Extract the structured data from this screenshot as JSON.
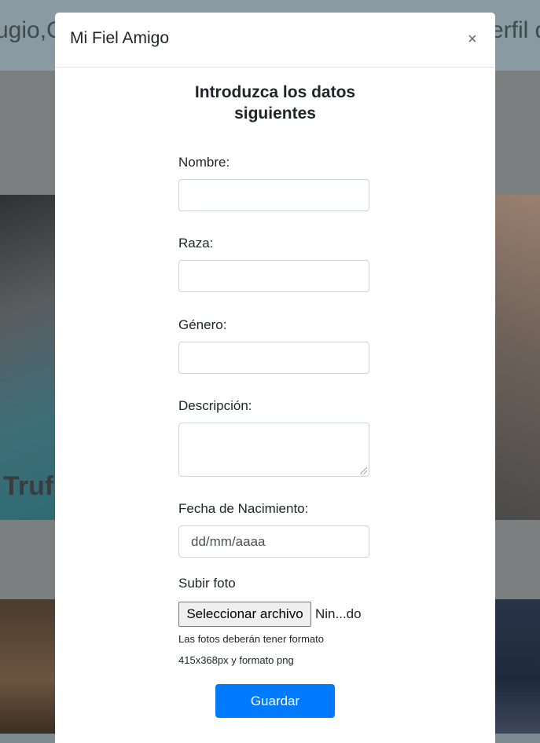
{
  "background": {
    "header_left_text": "ugio,C",
    "header_right_text": "erfil d",
    "photo_caption": "Truf"
  },
  "modal": {
    "title": "Mi Fiel Amigo",
    "close_symbol": "×",
    "heading_line1": "Introduzca los datos",
    "heading_line2": "siguientes"
  },
  "form": {
    "nombre_label": "Nombre:",
    "nombre_value": "",
    "raza_label": "Raza:",
    "raza_value": "",
    "genero_label": "Género:",
    "genero_value": "",
    "descripcion_label": "Descripción:",
    "descripcion_value": "",
    "fecha_label": "Fecha de Nacimiento:",
    "fecha_placeholder": "dd/mm/aaaa",
    "foto_label": "Subir foto",
    "file_button_label": "Seleccionar archivo",
    "file_status": "Nin...do",
    "help_line1": "Las fotos deberán tener formato",
    "help_line2": "415x368px y formato png",
    "save_label": "Guardar"
  },
  "colors": {
    "primary_button": "#007bff",
    "overlay": "#7d8a8f"
  }
}
